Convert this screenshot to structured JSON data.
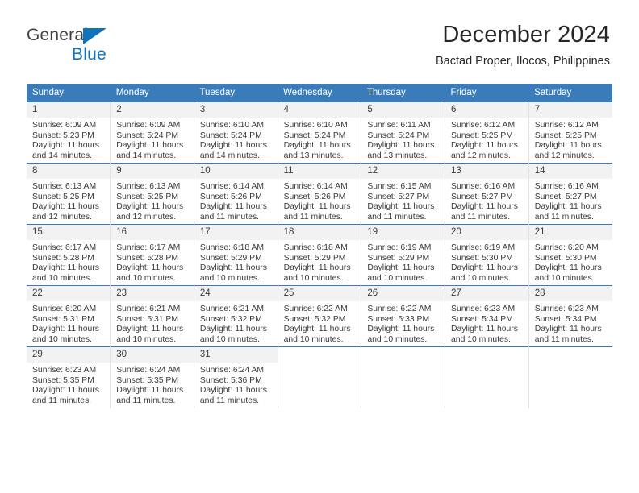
{
  "brand": {
    "name_part1": "General",
    "name_part2": "Blue",
    "accent_color": "#1273bd",
    "triangle_icon": "logo-triangle-icon"
  },
  "header": {
    "title": "December 2024",
    "subtitle": "Bactad Proper, Ilocos, Philippines"
  },
  "calendar": {
    "header_bg": "#3a7cb9",
    "daynum_bg": "#f2f2f2",
    "weekdays": [
      "Sunday",
      "Monday",
      "Tuesday",
      "Wednesday",
      "Thursday",
      "Friday",
      "Saturday"
    ],
    "weeks": [
      [
        {
          "day": "1",
          "sunrise": "Sunrise: 6:09 AM",
          "sunset": "Sunset: 5:23 PM",
          "daylight1": "Daylight: 11 hours",
          "daylight2": "and 14 minutes."
        },
        {
          "day": "2",
          "sunrise": "Sunrise: 6:09 AM",
          "sunset": "Sunset: 5:24 PM",
          "daylight1": "Daylight: 11 hours",
          "daylight2": "and 14 minutes."
        },
        {
          "day": "3",
          "sunrise": "Sunrise: 6:10 AM",
          "sunset": "Sunset: 5:24 PM",
          "daylight1": "Daylight: 11 hours",
          "daylight2": "and 14 minutes."
        },
        {
          "day": "4",
          "sunrise": "Sunrise: 6:10 AM",
          "sunset": "Sunset: 5:24 PM",
          "daylight1": "Daylight: 11 hours",
          "daylight2": "and 13 minutes."
        },
        {
          "day": "5",
          "sunrise": "Sunrise: 6:11 AM",
          "sunset": "Sunset: 5:24 PM",
          "daylight1": "Daylight: 11 hours",
          "daylight2": "and 13 minutes."
        },
        {
          "day": "6",
          "sunrise": "Sunrise: 6:12 AM",
          "sunset": "Sunset: 5:25 PM",
          "daylight1": "Daylight: 11 hours",
          "daylight2": "and 12 minutes."
        },
        {
          "day": "7",
          "sunrise": "Sunrise: 6:12 AM",
          "sunset": "Sunset: 5:25 PM",
          "daylight1": "Daylight: 11 hours",
          "daylight2": "and 12 minutes."
        }
      ],
      [
        {
          "day": "8",
          "sunrise": "Sunrise: 6:13 AM",
          "sunset": "Sunset: 5:25 PM",
          "daylight1": "Daylight: 11 hours",
          "daylight2": "and 12 minutes."
        },
        {
          "day": "9",
          "sunrise": "Sunrise: 6:13 AM",
          "sunset": "Sunset: 5:25 PM",
          "daylight1": "Daylight: 11 hours",
          "daylight2": "and 12 minutes."
        },
        {
          "day": "10",
          "sunrise": "Sunrise: 6:14 AM",
          "sunset": "Sunset: 5:26 PM",
          "daylight1": "Daylight: 11 hours",
          "daylight2": "and 11 minutes."
        },
        {
          "day": "11",
          "sunrise": "Sunrise: 6:14 AM",
          "sunset": "Sunset: 5:26 PM",
          "daylight1": "Daylight: 11 hours",
          "daylight2": "and 11 minutes."
        },
        {
          "day": "12",
          "sunrise": "Sunrise: 6:15 AM",
          "sunset": "Sunset: 5:27 PM",
          "daylight1": "Daylight: 11 hours",
          "daylight2": "and 11 minutes."
        },
        {
          "day": "13",
          "sunrise": "Sunrise: 6:16 AM",
          "sunset": "Sunset: 5:27 PM",
          "daylight1": "Daylight: 11 hours",
          "daylight2": "and 11 minutes."
        },
        {
          "day": "14",
          "sunrise": "Sunrise: 6:16 AM",
          "sunset": "Sunset: 5:27 PM",
          "daylight1": "Daylight: 11 hours",
          "daylight2": "and 11 minutes."
        }
      ],
      [
        {
          "day": "15",
          "sunrise": "Sunrise: 6:17 AM",
          "sunset": "Sunset: 5:28 PM",
          "daylight1": "Daylight: 11 hours",
          "daylight2": "and 10 minutes."
        },
        {
          "day": "16",
          "sunrise": "Sunrise: 6:17 AM",
          "sunset": "Sunset: 5:28 PM",
          "daylight1": "Daylight: 11 hours",
          "daylight2": "and 10 minutes."
        },
        {
          "day": "17",
          "sunrise": "Sunrise: 6:18 AM",
          "sunset": "Sunset: 5:29 PM",
          "daylight1": "Daylight: 11 hours",
          "daylight2": "and 10 minutes."
        },
        {
          "day": "18",
          "sunrise": "Sunrise: 6:18 AM",
          "sunset": "Sunset: 5:29 PM",
          "daylight1": "Daylight: 11 hours",
          "daylight2": "and 10 minutes."
        },
        {
          "day": "19",
          "sunrise": "Sunrise: 6:19 AM",
          "sunset": "Sunset: 5:29 PM",
          "daylight1": "Daylight: 11 hours",
          "daylight2": "and 10 minutes."
        },
        {
          "day": "20",
          "sunrise": "Sunrise: 6:19 AM",
          "sunset": "Sunset: 5:30 PM",
          "daylight1": "Daylight: 11 hours",
          "daylight2": "and 10 minutes."
        },
        {
          "day": "21",
          "sunrise": "Sunrise: 6:20 AM",
          "sunset": "Sunset: 5:30 PM",
          "daylight1": "Daylight: 11 hours",
          "daylight2": "and 10 minutes."
        }
      ],
      [
        {
          "day": "22",
          "sunrise": "Sunrise: 6:20 AM",
          "sunset": "Sunset: 5:31 PM",
          "daylight1": "Daylight: 11 hours",
          "daylight2": "and 10 minutes."
        },
        {
          "day": "23",
          "sunrise": "Sunrise: 6:21 AM",
          "sunset": "Sunset: 5:31 PM",
          "daylight1": "Daylight: 11 hours",
          "daylight2": "and 10 minutes."
        },
        {
          "day": "24",
          "sunrise": "Sunrise: 6:21 AM",
          "sunset": "Sunset: 5:32 PM",
          "daylight1": "Daylight: 11 hours",
          "daylight2": "and 10 minutes."
        },
        {
          "day": "25",
          "sunrise": "Sunrise: 6:22 AM",
          "sunset": "Sunset: 5:32 PM",
          "daylight1": "Daylight: 11 hours",
          "daylight2": "and 10 minutes."
        },
        {
          "day": "26",
          "sunrise": "Sunrise: 6:22 AM",
          "sunset": "Sunset: 5:33 PM",
          "daylight1": "Daylight: 11 hours",
          "daylight2": "and 10 minutes."
        },
        {
          "day": "27",
          "sunrise": "Sunrise: 6:23 AM",
          "sunset": "Sunset: 5:34 PM",
          "daylight1": "Daylight: 11 hours",
          "daylight2": "and 10 minutes."
        },
        {
          "day": "28",
          "sunrise": "Sunrise: 6:23 AM",
          "sunset": "Sunset: 5:34 PM",
          "daylight1": "Daylight: 11 hours",
          "daylight2": "and 11 minutes."
        }
      ],
      [
        {
          "day": "29",
          "sunrise": "Sunrise: 6:23 AM",
          "sunset": "Sunset: 5:35 PM",
          "daylight1": "Daylight: 11 hours",
          "daylight2": "and 11 minutes."
        },
        {
          "day": "30",
          "sunrise": "Sunrise: 6:24 AM",
          "sunset": "Sunset: 5:35 PM",
          "daylight1": "Daylight: 11 hours",
          "daylight2": "and 11 minutes."
        },
        {
          "day": "31",
          "sunrise": "Sunrise: 6:24 AM",
          "sunset": "Sunset: 5:36 PM",
          "daylight1": "Daylight: 11 hours",
          "daylight2": "and 11 minutes."
        },
        {
          "day": "",
          "sunrise": "",
          "sunset": "",
          "daylight1": "",
          "daylight2": ""
        },
        {
          "day": "",
          "sunrise": "",
          "sunset": "",
          "daylight1": "",
          "daylight2": ""
        },
        {
          "day": "",
          "sunrise": "",
          "sunset": "",
          "daylight1": "",
          "daylight2": ""
        },
        {
          "day": "",
          "sunrise": "",
          "sunset": "",
          "daylight1": "",
          "daylight2": ""
        }
      ]
    ]
  }
}
